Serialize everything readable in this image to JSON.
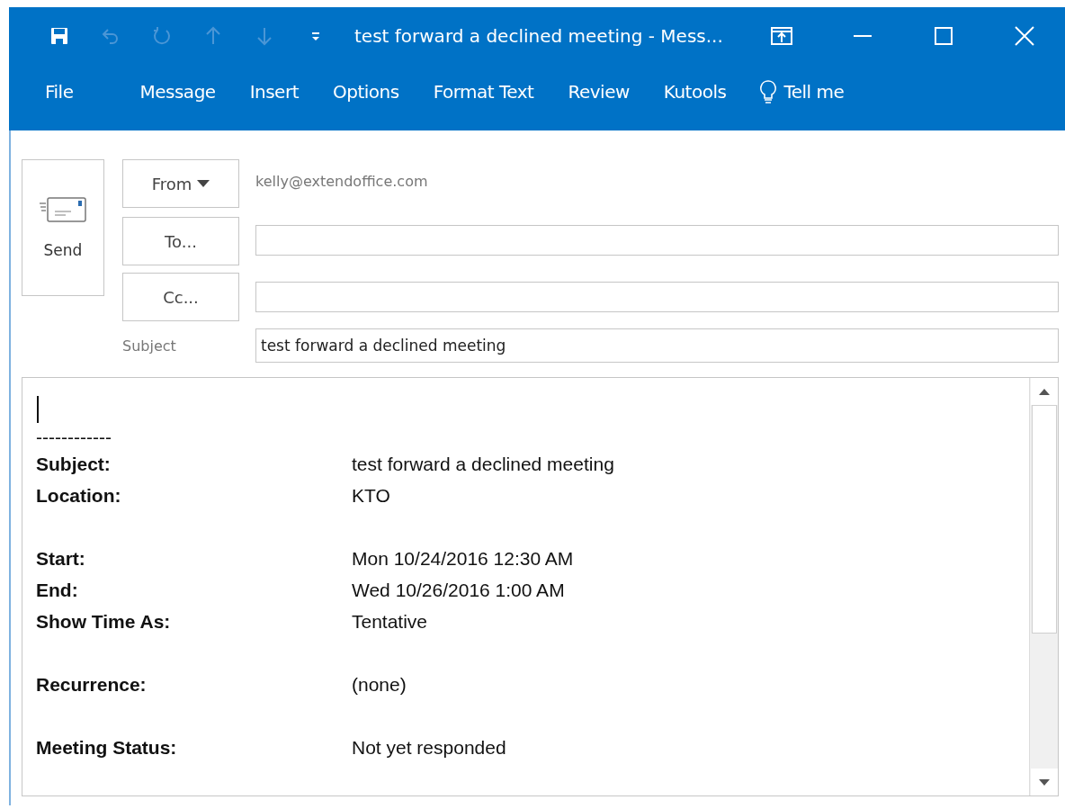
{
  "window": {
    "title": "test forward a declined meeting - Mess...",
    "quick_access": [
      {
        "kind": "save",
        "disabled": false
      },
      {
        "kind": "undo",
        "disabled": true
      },
      {
        "kind": "redo",
        "disabled": true
      },
      {
        "kind": "up",
        "disabled": true
      },
      {
        "kind": "down",
        "disabled": true
      },
      {
        "kind": "customize",
        "disabled": false
      }
    ]
  },
  "ribbon_tabs": [
    {
      "label": "File"
    },
    {
      "label": "Message"
    },
    {
      "label": "Insert"
    },
    {
      "label": "Options"
    },
    {
      "label": "Format Text"
    },
    {
      "label": "Review"
    },
    {
      "label": "Kutools"
    },
    {
      "label": "Tell me",
      "kind": "search"
    }
  ],
  "header": {
    "send": "Send",
    "from_button": "From",
    "from_value": "kelly@extendoffice.com",
    "to_button": "To...",
    "cc_button": "Cc...",
    "subject_label": "Subject",
    "subject_value": "test forward a declined meeting"
  },
  "body": {
    "separator": "------------",
    "groups": [
      [
        {
          "label": "Subject:",
          "value": "test forward a declined meeting"
        },
        {
          "label": "Location:",
          "value": "KTO"
        }
      ],
      [
        {
          "label": "Start:",
          "value": "Mon 10/24/2016 12:30 AM"
        },
        {
          "label": "End:",
          "value": "Wed 10/26/2016 1:00 AM"
        },
        {
          "label": "Show Time As:",
          "value": "Tentative"
        }
      ],
      [
        {
          "label": "Recurrence:",
          "value": "(none)"
        }
      ],
      [
        {
          "label": "Meeting Status:",
          "value": "Not yet responded"
        }
      ]
    ]
  }
}
